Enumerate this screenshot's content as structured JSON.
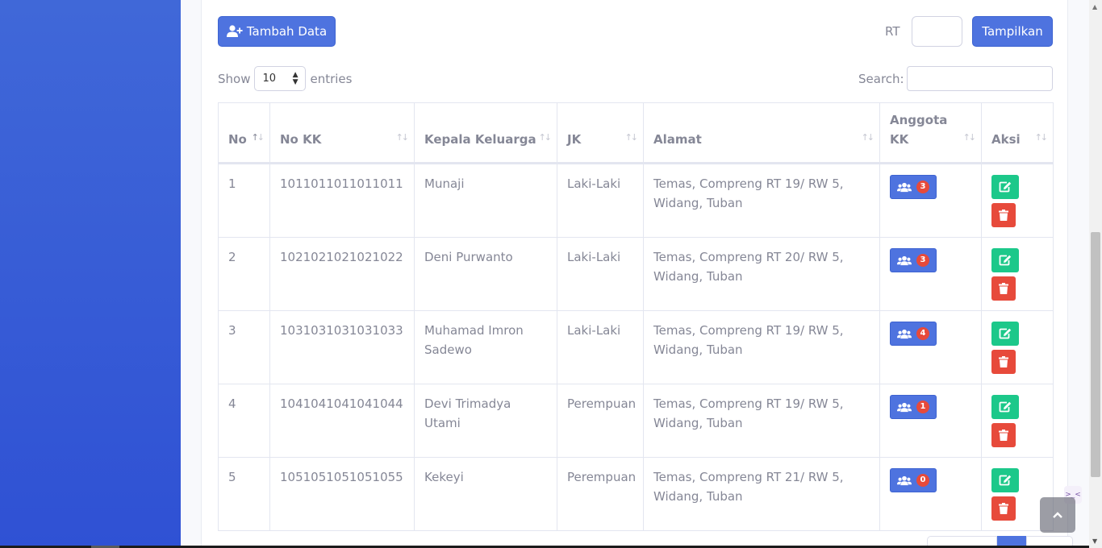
{
  "toolbar": {
    "add_label": "Tambah Data",
    "rt_label": "RT",
    "rt_value": "",
    "show_label": "Tampilkan"
  },
  "controls": {
    "show_prefix": "Show",
    "entries_value": "10",
    "show_suffix": "entries",
    "search_label": "Search:",
    "search_value": ""
  },
  "table": {
    "headers": [
      "No",
      "No KK",
      "Kepala Keluarga",
      "JK",
      "Alamat",
      "Anggota KK",
      "Aksi"
    ],
    "rows": [
      {
        "no": "1",
        "no_kk": "1011011011011011",
        "kepala": "Munaji",
        "jk": "Laki-Laki",
        "alamat": "Temas, Compreng RT 19/ RW 5, Widang, Tuban",
        "anggota": "3"
      },
      {
        "no": "2",
        "no_kk": "1021021021021022",
        "kepala": "Deni Purwanto",
        "jk": "Laki-Laki",
        "alamat": "Temas, Compreng RT 20/ RW 5, Widang, Tuban",
        "anggota": "3"
      },
      {
        "no": "3",
        "no_kk": "1031031031031033",
        "kepala": "Muhamad Imron Sadewo",
        "jk": "Laki-Laki",
        "alamat": "Temas, Compreng RT 19/ RW 5, Widang, Tuban",
        "anggota": "4"
      },
      {
        "no": "4",
        "no_kk": "1041041041041044",
        "kepala": "Devi Trimadya Utami",
        "jk": "Perempuan",
        "alamat": "Temas, Compreng RT 19/ RW 5, Widang, Tuban",
        "anggota": "1"
      },
      {
        "no": "5",
        "no_kk": "1051051051051055",
        "kepala": "Kekeyi",
        "jk": "Perempuan",
        "alamat": "Temas, Compreng RT 21/ RW 5, Widang, Tuban",
        "anggota": "0"
      }
    ]
  },
  "icons": {
    "add": "user-plus-icon",
    "members": "users-icon",
    "edit": "edit-icon",
    "delete": "trash-icon",
    "scroll_top": "chevron-up-icon"
  },
  "colors": {
    "primary": "#4e73df",
    "success": "#1cc88a",
    "danger": "#e74a3b",
    "sidebar": "#3b5fd6"
  }
}
